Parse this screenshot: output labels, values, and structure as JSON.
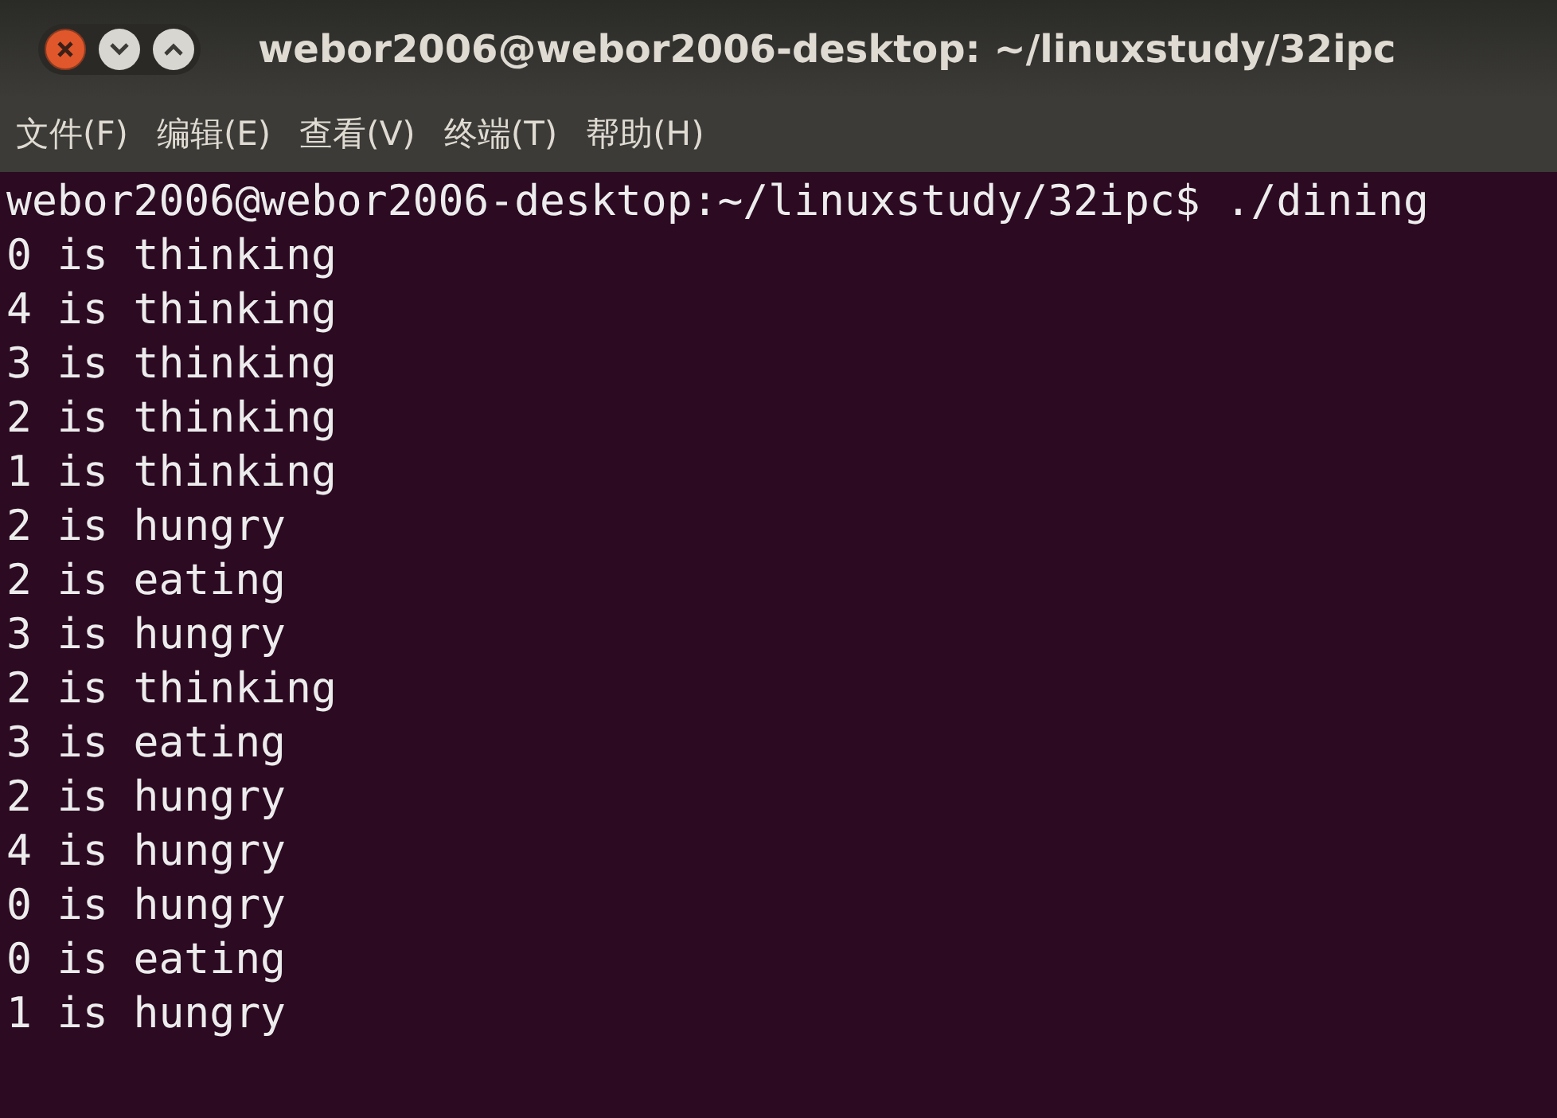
{
  "window": {
    "title": "webor2006@webor2006-desktop: ~/linuxstudy/32ipc"
  },
  "menu": [
    "文件(F)",
    "编辑(E)",
    "查看(V)",
    "终端(T)",
    "帮助(H)"
  ],
  "terminal": {
    "lines": [
      "webor2006@webor2006-desktop:~/linuxstudy/32ipc$ ./dining",
      "0 is thinking",
      "4 is thinking",
      "3 is thinking",
      "2 is thinking",
      "1 is thinking",
      "2 is hungry",
      "2 is eating",
      "3 is hungry",
      "2 is thinking",
      "3 is eating",
      "2 is hungry",
      "4 is hungry",
      "0 is hungry",
      "0 is eating",
      "1 is hungry"
    ]
  }
}
